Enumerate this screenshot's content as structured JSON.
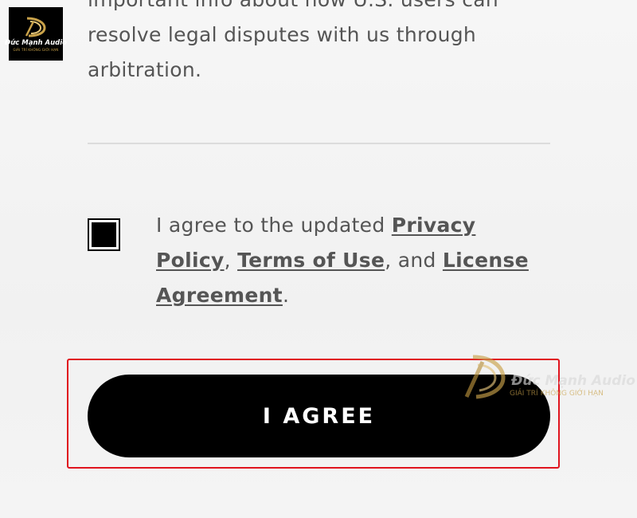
{
  "logo": {
    "name": "Đức Mạnh Audio",
    "tagline": "GIẢI TRÍ KHÔNG GIỚI HẠN",
    "gold": "#c9a24a"
  },
  "watermark": {
    "name": "Đức Mạnh Audio",
    "tagline": "GIẢI TRÍ KHÔNG GIỚI HẠN"
  },
  "content": {
    "partial_text_line1": "important info about how U.S. users can",
    "partial_text_line2": "resolve legal disputes with us through",
    "partial_text_line3": "arbitration."
  },
  "agreement": {
    "checked": true,
    "prefix": "I agree to the updated ",
    "privacy_link": "Privacy Policy",
    "sep1": ", ",
    "terms_link": "Terms of Use",
    "sep2": ", and ",
    "license_link": "License Agreement",
    "suffix": "."
  },
  "button": {
    "label": "I AGREE"
  },
  "colors": {
    "highlight": "#e0141e",
    "button_bg": "#000000",
    "text": "#555555"
  }
}
